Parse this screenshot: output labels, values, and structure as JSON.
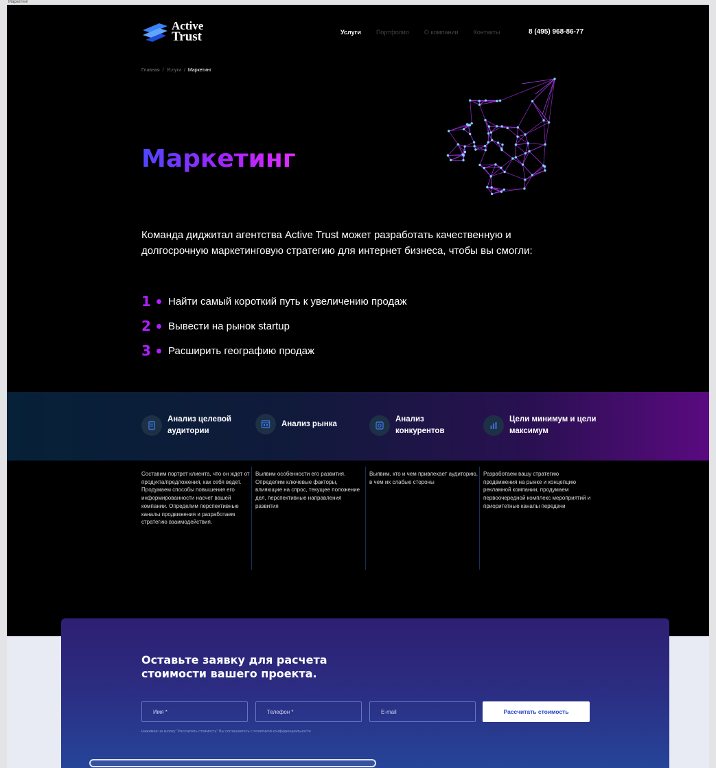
{
  "frame_label": "Маркетинг",
  "header": {
    "logo": {
      "line1": "Active",
      "line2": "Trust"
    },
    "nav": [
      {
        "label": "Услуги",
        "active": true
      },
      {
        "label": "Портфолио",
        "active": false
      },
      {
        "label": "О компании",
        "active": false
      },
      {
        "label": "Контакты",
        "active": false
      }
    ],
    "phone": "8 (495) 968-86-77"
  },
  "breadcrumb": {
    "home": "Главная",
    "sep": "/",
    "services": "Услуги",
    "current": "Маркетинг"
  },
  "hero": {
    "title": "Маркетинг",
    "intro": "Команда диджитал агентства Active Trust может разработать качественную и долгосрочную маркетинговую стратегию для интернет бизнеса, чтобы вы смогли:",
    "goals": [
      {
        "num": "1",
        "text": "Найти самый короткий путь к увеличению продаж"
      },
      {
        "num": "2",
        "text": "Вывести на рынок startup"
      },
      {
        "num": "3",
        "text": "Расширить географию продаж"
      }
    ]
  },
  "features": [
    {
      "title": "Анализ целевой аудитории",
      "icon": "document-icon",
      "desc": "Составим портрет клиента, что он ждет от продукта/предложения, как себя ведет. Продумаем способы повышения его информированности насчет вашей компании. Определим перспективные каналы продвижения и разработаем стратегию взаимодействия."
    },
    {
      "title": "Анализ рынка",
      "icon": "market-icon",
      "desc": "Выявим особенности его развития. Определим ключевые факторы, влияющие на спрос, текущее положение дел, перспективные направления развития"
    },
    {
      "title": "Анализ конкурентов",
      "icon": "competitors-icon",
      "desc": "Выявим, кто и чем привлекает аудиторию, в чем их слабые стороны"
    },
    {
      "title": "Цели минимум и цели максимум",
      "icon": "chart-icon",
      "desc": "Разработаем вашу стратегию продвижения на рынке и концепцию рекламной компании, продумаем первоочередной комплекс мероприятий и приоритетные каналы передачи"
    }
  ],
  "form": {
    "title": "Оставьте заявку для расчета стоимости вашего проекта.",
    "name_placeholder": "Имя *",
    "phone_placeholder": "Телефон *",
    "email_placeholder": "E-mail",
    "submit_label": "Рассчитать стоимость",
    "consent": "Нажимая на кнопку \"Рассчитать стоимость\" Вы соглашаетесь с политикой конфиденциальности"
  },
  "colors": {
    "accent": "#b01fff",
    "background": "#000000",
    "card_top": "#2e1f72",
    "card_bottom": "#25479b"
  }
}
